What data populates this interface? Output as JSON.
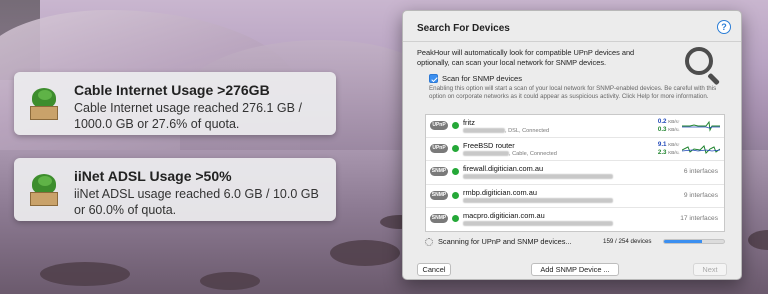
{
  "notifications": [
    {
      "title": "Cable Internet Usage >276GB",
      "body": "Cable Internet usage reached 276.1 GB / 1000.0 GB or 27.6% of quota.",
      "icon": "peakhour-app-icon"
    },
    {
      "title": "iiNet ADSL Usage >50%",
      "body": "iiNet ADSL usage reached 6.0 GB / 10.0 GB or 60.0% of quota.",
      "icon": "peakhour-app-icon"
    }
  ],
  "dialog": {
    "title": "Search For Devices",
    "help_label": "?",
    "intro": "PeakHour will automatically look for compatible UPnP devices and optionally, can scan your local network for SNMP devices.",
    "snmp_checkbox_label": "Scan for SNMP devices",
    "snmp_checked": true,
    "snmp_description": "Enabling this option will start a scan of your local network for SNMP-enabled devices. Be careful with this option on corporate networks as it could appear as suspicious activity. Click Help for more information.",
    "devices": [
      {
        "protocol": "UPnP",
        "name": "fritz",
        "sub_suffix": ", DSL, Connected",
        "down": "0.2",
        "up": "0.3",
        "down_unit": "KB/s↑",
        "up_unit": "KB/s↓",
        "status_color": "#25a838"
      },
      {
        "protocol": "UPnP",
        "name": "FreeBSD router",
        "sub_suffix": ", Cable, Connected",
        "down": "9.1",
        "up": "2.3",
        "down_unit": "KB/s↑",
        "up_unit": "KB/s↓",
        "status_color": "#25a838"
      },
      {
        "protocol": "SNMP",
        "name": "firewall.digitician.com.au",
        "interfaces": "6 interfaces",
        "status_color": "#25a838"
      },
      {
        "protocol": "SNMP",
        "name": "rmbp.digitician.com.au",
        "interfaces": "9 interfaces",
        "status_color": "#25a838"
      },
      {
        "protocol": "SNMP",
        "name": "macpro.digitician.com.au",
        "interfaces": "17 interfaces",
        "status_color": "#25a838"
      }
    ],
    "scan_status": "Scanning for UPnP and SNMP devices...",
    "scan_count": "159 / 254 devices",
    "scan_progress": 0.626,
    "buttons": {
      "cancel": "Cancel",
      "add": "Add SNMP Device ...",
      "next": "Next"
    }
  },
  "colors": {
    "accent": "#3b8ff0",
    "online": "#25a838",
    "download": "#1f47b8",
    "upload": "#21852f"
  }
}
